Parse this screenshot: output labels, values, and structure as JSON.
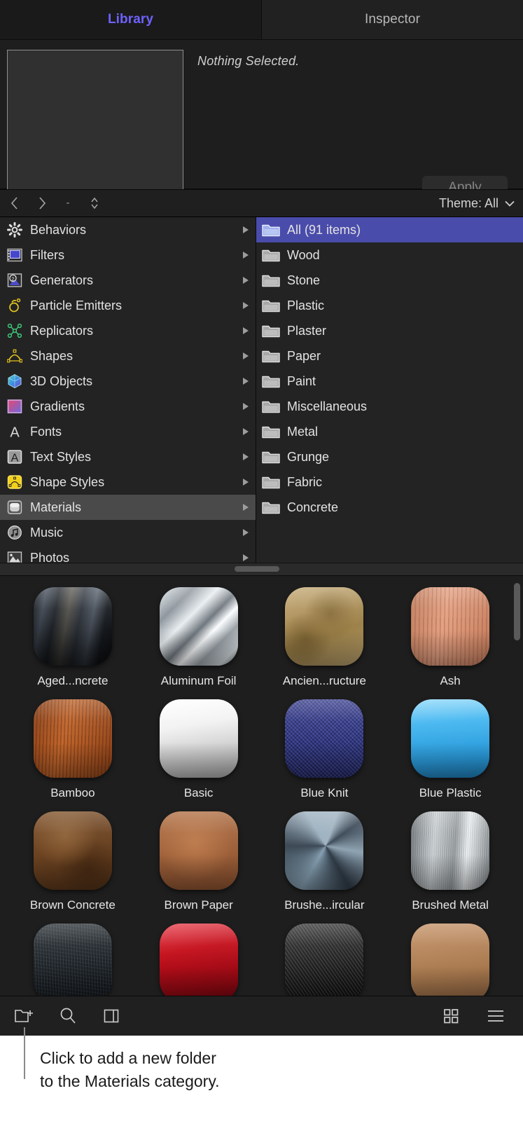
{
  "tabs": [
    {
      "label": "Library",
      "active": true
    },
    {
      "label": "Inspector",
      "active": false
    }
  ],
  "inspector": {
    "status_text": "Nothing Selected.",
    "apply_label": "Apply"
  },
  "navbar": {
    "back_icon": "chevron-left-icon",
    "forward_icon": "chevron-right-icon",
    "separator": "-",
    "stepper_icon": "stepper-up-down-icon",
    "theme_label": "Theme: All",
    "theme_chevron": "chevron-down-icon"
  },
  "categories": [
    {
      "label": "Behaviors",
      "icon": "gear-icon",
      "selected": false
    },
    {
      "label": "Filters",
      "icon": "filmstrip-icon",
      "selected": false
    },
    {
      "label": "Generators",
      "icon": "generator-icon",
      "selected": false
    },
    {
      "label": "Particle Emitters",
      "icon": "particle-emitter-icon",
      "selected": false
    },
    {
      "label": "Replicators",
      "icon": "replicator-icon",
      "selected": false
    },
    {
      "label": "Shapes",
      "icon": "shape-icon",
      "selected": false
    },
    {
      "label": "3D Objects",
      "icon": "cube-icon",
      "selected": false
    },
    {
      "label": "Gradients",
      "icon": "gradient-icon",
      "selected": false
    },
    {
      "label": "Fonts",
      "icon": "font-a-icon",
      "selected": false
    },
    {
      "label": "Text Styles",
      "icon": "text-style-icon",
      "selected": false
    },
    {
      "label": "Shape Styles",
      "icon": "shape-style-icon",
      "selected": false
    },
    {
      "label": "Materials",
      "icon": "material-icon",
      "selected": true
    },
    {
      "label": "Music",
      "icon": "music-note-icon",
      "selected": false
    },
    {
      "label": "Photos",
      "icon": "photo-icon",
      "selected": false
    }
  ],
  "folders": [
    {
      "label": "All (91 items)",
      "selected": true
    },
    {
      "label": "Wood",
      "selected": false
    },
    {
      "label": "Stone",
      "selected": false
    },
    {
      "label": "Plastic",
      "selected": false
    },
    {
      "label": "Plaster",
      "selected": false
    },
    {
      "label": "Paper",
      "selected": false
    },
    {
      "label": "Paint",
      "selected": false
    },
    {
      "label": "Miscellaneous",
      "selected": false
    },
    {
      "label": "Metal",
      "selected": false
    },
    {
      "label": "Grunge",
      "selected": false
    },
    {
      "label": "Fabric",
      "selected": false
    },
    {
      "label": "Concrete",
      "selected": false
    }
  ],
  "materials": [
    {
      "label": "Aged...ncrete",
      "swatch": "aged-concrete"
    },
    {
      "label": "Aluminum Foil",
      "swatch": "aluminum-foil"
    },
    {
      "label": "Ancien...ructure",
      "swatch": "ancient-structure"
    },
    {
      "label": "Ash",
      "swatch": "ash"
    },
    {
      "label": "Bamboo",
      "swatch": "bamboo"
    },
    {
      "label": "Basic",
      "swatch": "basic"
    },
    {
      "label": "Blue Knit",
      "swatch": "blue-knit"
    },
    {
      "label": "Blue Plastic",
      "swatch": "blue-plastic"
    },
    {
      "label": "Brown Concrete",
      "swatch": "brown-concrete"
    },
    {
      "label": "Brown Paper",
      "swatch": "brown-paper"
    },
    {
      "label": "Brushe...ircular",
      "swatch": "brushed-circular"
    },
    {
      "label": "Brushed Metal",
      "swatch": "brushed-metal"
    },
    {
      "label": "",
      "swatch": "black-rough"
    },
    {
      "label": "",
      "swatch": "red-gloss"
    },
    {
      "label": "",
      "swatch": "carbon-fiber"
    },
    {
      "label": "",
      "swatch": "tan-cardboard"
    }
  ],
  "toolbar": {
    "new_folder_icon": "new-folder-icon",
    "search_icon": "search-icon",
    "sidebar_icon": "sidebar-toggle-icon",
    "grid_view_icon": "grid-view-icon",
    "list_view_icon": "list-view-icon"
  },
  "caption": {
    "line1": "Click to add a new folder",
    "line2": "to the Materials category."
  },
  "colors": {
    "accent": "#6e62ff",
    "selection": "#4a4cab",
    "panel_bg": "#1c1c1c",
    "row_selected": "#4a4a4a"
  }
}
